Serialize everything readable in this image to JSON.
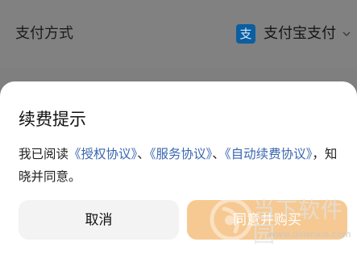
{
  "background": {
    "payment_method_label": "支付方式",
    "selected_method": "支付宝支付",
    "alipay_logo_char": "支"
  },
  "dialog": {
    "title": "续费提示",
    "text_prefix": "我已阅读",
    "link_authorization": "《授权协议》",
    "separator_1": "、",
    "link_service": "《服务协议》",
    "separator_2": "、",
    "link_auto_renew": "《自动续费协议》",
    "text_suffix": "，知晓并同意。",
    "cancel_label": "取消",
    "confirm_label": "同意并购买"
  },
  "watermark": {
    "name": "当下软件园",
    "url": "www.downxia.com"
  },
  "colors": {
    "link": "#3a67b0",
    "confirm_bg": "#f6c992",
    "alipay_blue": "#0b5e9f"
  },
  "icons": [
    "alipay-icon",
    "chevron-down-icon",
    "watermark-logo-icon"
  ]
}
